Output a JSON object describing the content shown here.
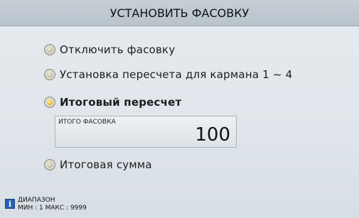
{
  "title": "УСТАНОВИТЬ ФАСОВКУ",
  "options": [
    {
      "label": "Отключить фасовку",
      "selected": false
    },
    {
      "label": "Установка пересчета для кармана 1 ~ 4",
      "selected": false
    },
    {
      "label": "Итоговый пересчет",
      "selected": true
    },
    {
      "label": "Итоговая сумма",
      "selected": false
    }
  ],
  "total_box": {
    "label": "ИТОГО ФАСОВКА",
    "value": "100"
  },
  "footer": {
    "icon": "info-icon",
    "range_title": "ДИАПАЗОН",
    "range_values": "МИН : 1  МАКС : 9999"
  },
  "colors": {
    "title_bar": "#bcc6ce",
    "background": "#dfe5ea",
    "selected_radio": "#f0c13a",
    "info_icon": "#2b5fb5"
  }
}
